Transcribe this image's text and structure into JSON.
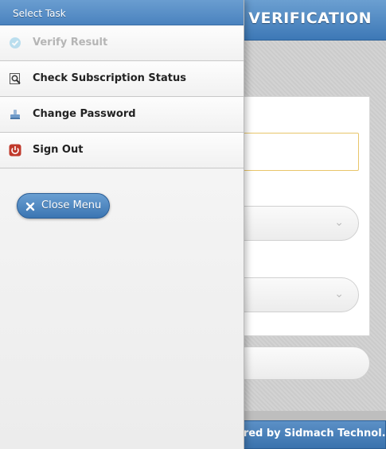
{
  "page": {
    "title": "ULT VERIFICATION",
    "footer_text": "ered by Sidmach Technol...",
    "accent_color": "#4a83bf"
  },
  "panel": {
    "header": "Select Task",
    "items": [
      {
        "label": "Verify Result",
        "icon": "check-circle-icon",
        "disabled": true
      },
      {
        "label": "Check Subscription Status",
        "icon": "magnifier-document-icon",
        "disabled": false
      },
      {
        "label": "Change Password",
        "icon": "password-stamp-icon",
        "disabled": false
      },
      {
        "label": "Sign Out",
        "icon": "power-icon",
        "disabled": false
      }
    ],
    "close_button": "Close Menu"
  }
}
